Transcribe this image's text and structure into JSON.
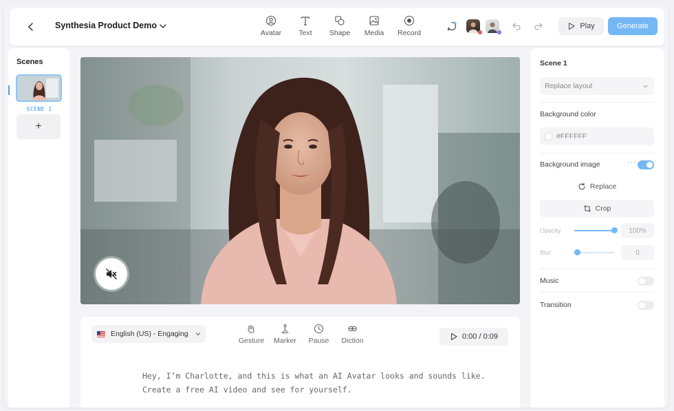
{
  "topbar": {
    "project_title": "Synthesia Product Demo",
    "tools": [
      {
        "label": "Avatar",
        "icon": "avatar-icon"
      },
      {
        "label": "Text",
        "icon": "text-icon"
      },
      {
        "label": "Shape",
        "icon": "shape-icon"
      },
      {
        "label": "Media",
        "icon": "media-icon"
      },
      {
        "label": "Record",
        "icon": "record-icon"
      }
    ],
    "play_label": "Play",
    "generate_label": "Generate"
  },
  "scenes": {
    "title": "Scenes",
    "items": [
      {
        "label": "SCENE 1"
      }
    ],
    "add_label": "+"
  },
  "script": {
    "language": "English (US) - Engaging",
    "tools": [
      {
        "label": "Gesture",
        "icon": "gesture-icon"
      },
      {
        "label": "Marker",
        "icon": "marker-icon"
      },
      {
        "label": "Pause",
        "icon": "clock-icon"
      },
      {
        "label": "Diction",
        "icon": "diction-icon"
      }
    ],
    "timer": "0:00 / 0:09",
    "text": "Hey, I’m Charlotte, and this is what an AI Avatar looks and sounds like. Create a free AI video and see for yourself."
  },
  "props": {
    "scene_title": "Scene 1",
    "layout_select": "Replace layout",
    "bg_color_label": "Background color",
    "bg_color_value": "#FFFFFF",
    "bg_image_label": "Background image",
    "bg_image_enabled": true,
    "replace_label": "Replace",
    "crop_label": "Crop",
    "opacity_label": "Opacity",
    "opacity_value": "100%",
    "opacity_level": 1.0,
    "blur_label": "Blur",
    "blur_value": "0",
    "blur_level": 0,
    "music_label": "Music",
    "music_enabled": false,
    "transition_label": "Transition",
    "transition_enabled": false
  },
  "colors": {
    "accent": "#74b7f4",
    "scene_label": "#3a8fe6"
  }
}
